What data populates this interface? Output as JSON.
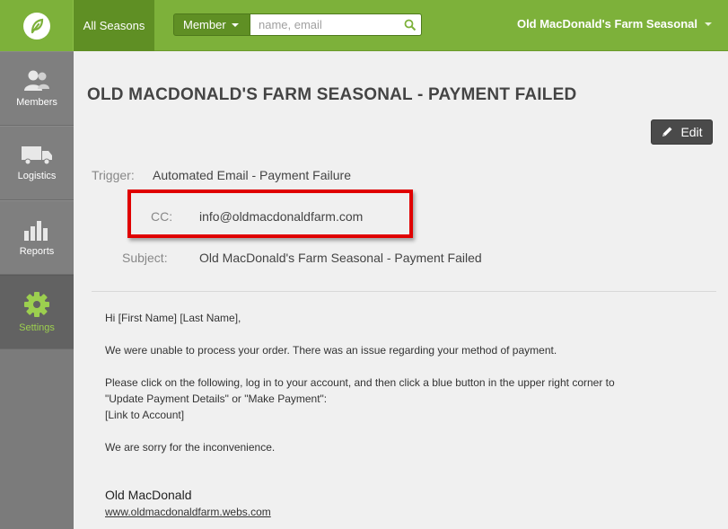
{
  "topbar": {
    "seasons_tab": "All Seasons",
    "member_dropdown": "Member",
    "search_placeholder": "name, email",
    "account_name": "Old MacDonald's Farm Seasonal"
  },
  "sidebar": {
    "items": [
      {
        "label": "Members",
        "icon": "members-icon"
      },
      {
        "label": "Logistics",
        "icon": "truck-icon"
      },
      {
        "label": "Reports",
        "icon": "bar-chart-icon"
      },
      {
        "label": "Settings",
        "icon": "gear-icon",
        "active": true
      }
    ]
  },
  "page": {
    "title": "OLD MACDONALD'S FARM SEASONAL - PAYMENT FAILED",
    "edit_label": "Edit"
  },
  "details": {
    "trigger_label": "Trigger:",
    "trigger_value": "Automated Email - Payment Failure",
    "cc_label": "CC:",
    "cc_value": "info@oldmacdonaldfarm.com",
    "subject_label": "Subject:",
    "subject_value": "Old MacDonald's Farm Seasonal - Payment Failed"
  },
  "email_body": {
    "greeting": "Hi [First Name] [Last Name],",
    "para1": "We were unable to process your order. There was an issue regarding your method of payment.",
    "para2_line1": "Please click on the following, log in to your account, and then click a blue button in the upper right corner to",
    "para2_line2": "\"Update Payment Details\" or \"Make Payment\":",
    "para2_line3": "[Link to Account]",
    "para3": "We are sorry for the inconvenience.",
    "signature_name": "Old MacDonald",
    "signature_link": "www.oldmacdonaldfarm.webs.com"
  },
  "colors": {
    "brand_green": "#7db13a",
    "dark_green": "#5f8f24",
    "highlight_red": "#e00000",
    "active_settings": "#9ccf4f"
  }
}
